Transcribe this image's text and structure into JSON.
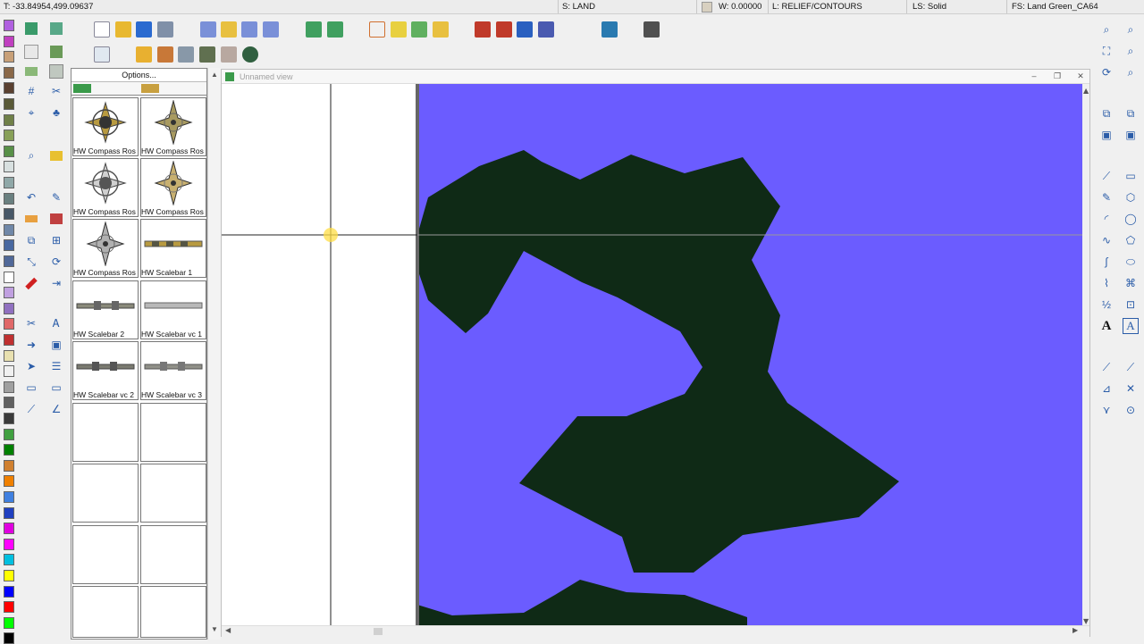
{
  "status": {
    "coords": "T: -33.84954,499.09637",
    "sheet": "S: LAND",
    "width": "W: 0.00000",
    "layer": "L: RELIEF/CONTOURS",
    "line_style": "LS: Solid",
    "fill_style": "FS: Land Green_CA64"
  },
  "panel": {
    "options_label": "Options...",
    "symbols": [
      {
        "label": "HW Compass Ros"
      },
      {
        "label": "HW Compass Ros"
      },
      {
        "label": "HW Compass Ros"
      },
      {
        "label": "HW Compass Ros"
      },
      {
        "label": "HW Compass Ros"
      },
      {
        "label": "HW Scalebar 1"
      },
      {
        "label": "HW Scalebar 2"
      },
      {
        "label": "HW Scalebar vc 1"
      },
      {
        "label": "HW Scalebar vc 2"
      },
      {
        "label": "HW Scalebar vc 3"
      }
    ]
  },
  "map_window": {
    "title": "Unnamed view",
    "minimize": "–",
    "maximize": "❐",
    "close": "✕"
  },
  "colors": {
    "sea": "#6b5cff",
    "land": "#0f2a16",
    "palette": [
      "#b060e0",
      "#c040c0",
      "#c8a078",
      "#8a6848",
      "#5a4030",
      "#5a5a38",
      "#708048",
      "#88a058",
      "#589048",
      "#d8e0e0",
      "#90a8a8",
      "#6a8080",
      "#485868",
      "#7088a8",
      "#4868a0",
      "#506898",
      "#ffffff",
      "#c0a0e0",
      "#9070c0",
      "#e06868",
      "#c03030",
      "#e8e0b0",
      "#f0f0f0",
      "#a0a0a0",
      "#606060",
      "#3a3a3a",
      "#40a040",
      "#008000",
      "#d08030",
      "#f08000",
      "#4080e0",
      "#2040c0",
      "#e000e0",
      "#ff00ff",
      "#00c0e0",
      "#ffff00",
      "#0000ff",
      "#ff0000",
      "#00ff00",
      "#000000"
    ]
  }
}
